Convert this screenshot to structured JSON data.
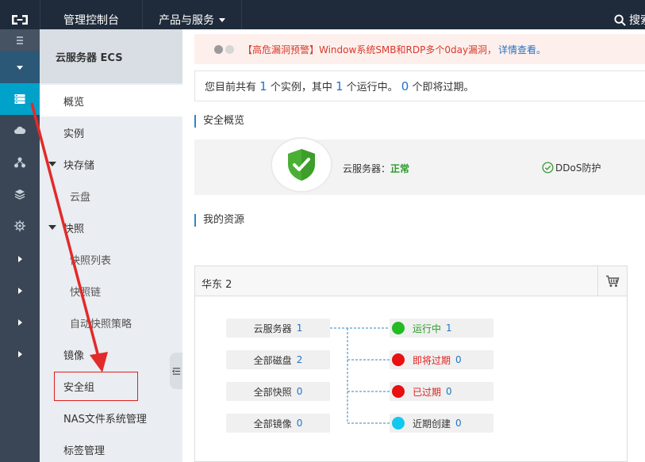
{
  "topbar": {
    "console_label": "管理控制台",
    "products_label": "产品与服务",
    "search_label": "搜索"
  },
  "subnav": {
    "title": "云服务器 ECS",
    "items": [
      {
        "label": "概览"
      },
      {
        "label": "实例"
      },
      {
        "label": "块存储"
      },
      {
        "label": "云盘"
      },
      {
        "label": "快照"
      },
      {
        "label": "快照列表"
      },
      {
        "label": "快照链"
      },
      {
        "label": "自动快照策略"
      },
      {
        "label": "镜像"
      },
      {
        "label": "安全组"
      },
      {
        "label": "NAS文件系统管理"
      },
      {
        "label": "标签管理"
      }
    ]
  },
  "alert": {
    "text": "【高危漏洞预警】Window系统SMB和RDP多个0day漏洞，",
    "link": "详情查看。"
  },
  "instances": {
    "prefix": "您目前共有 ",
    "total": "1",
    "mid1": " 个实例，其中 ",
    "running": "1",
    "mid2": " 个运行中。 ",
    "expiring": "0",
    "suffix": " 个即将过期。"
  },
  "security": {
    "title": "安全概览",
    "server_label": "云服务器：",
    "server_status": "正常",
    "ddos_label": "DDoS防护"
  },
  "resources": {
    "title": "我的资源",
    "region": "华东 2",
    "left": [
      {
        "label": "云服务器",
        "count": "1"
      },
      {
        "label": "全部磁盘",
        "count": "2"
      },
      {
        "label": "全部快照",
        "count": "0"
      },
      {
        "label": "全部镜像",
        "count": "0"
      }
    ],
    "right": [
      {
        "label": "运行中",
        "count": "1",
        "color": "#22bb22"
      },
      {
        "label": "即将过期",
        "count": "0",
        "color": "#e81010"
      },
      {
        "label": "已过期",
        "count": "0",
        "color": "#e81010"
      },
      {
        "label": "近期创建",
        "count": "0",
        "color": "#11c8f0"
      }
    ]
  },
  "colors": {
    "topbar": "#1f2b3a",
    "rail": "#3a4655",
    "active_rail": "#00a2ca",
    "accent_blue": "#2273c6",
    "alert_red": "#d9382c",
    "ok_green": "#2b9b2b",
    "annotation_red": "#e02020"
  },
  "icons": [
    "logo-icon",
    "search-icon",
    "menu-icon",
    "server-icon",
    "cloud-icon",
    "network-icon",
    "database-icon",
    "gear-icon",
    "shield-check-icon",
    "check-circle-icon",
    "cart-icon",
    "collapse-icon"
  ]
}
